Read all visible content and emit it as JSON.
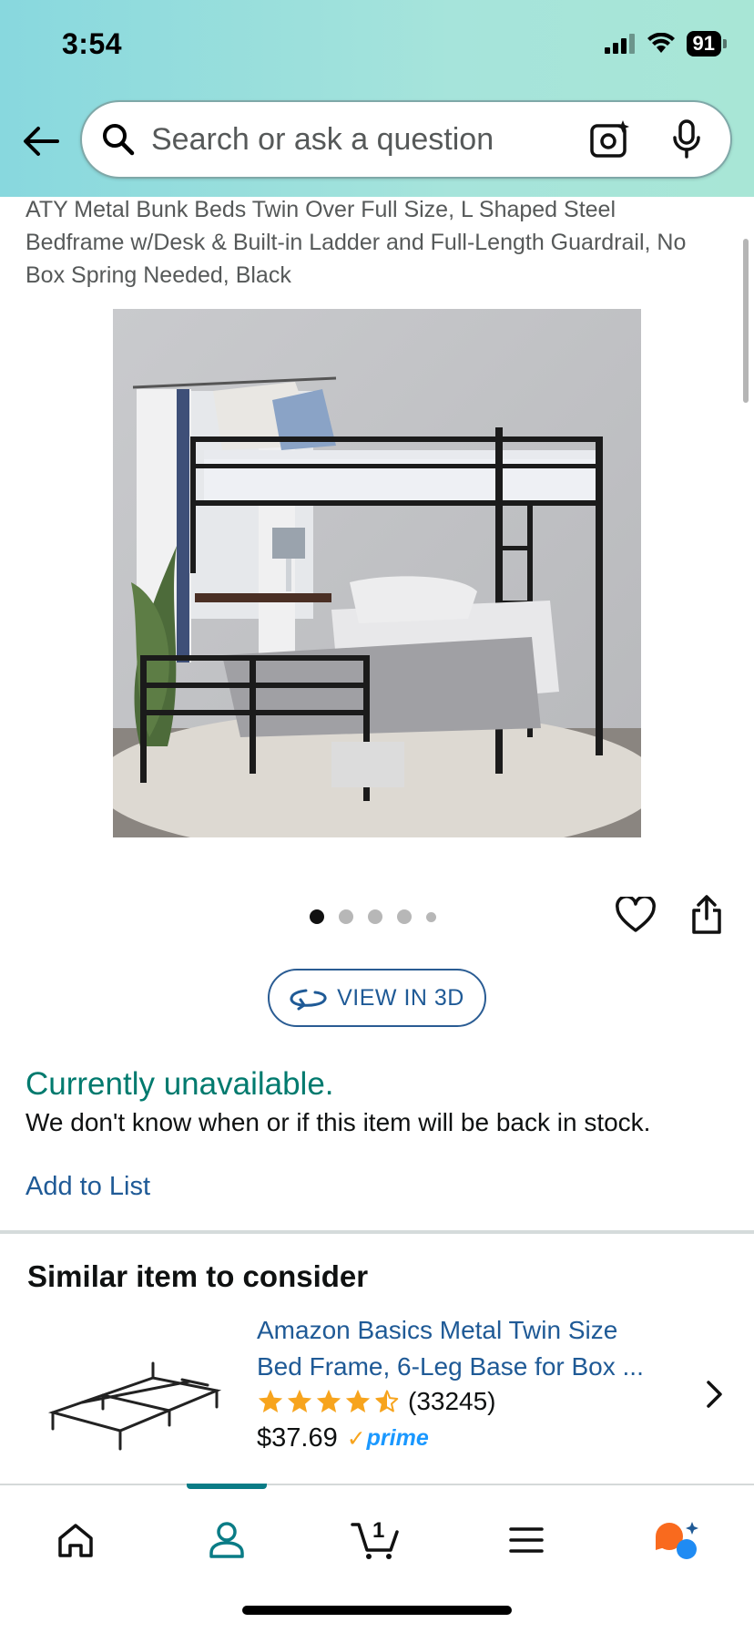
{
  "status_bar": {
    "time": "3:54",
    "battery": "91"
  },
  "search": {
    "placeholder": "Search or ask a question"
  },
  "product": {
    "title": "ATY Metal Bunk Beds Twin Over Full Size, L Shaped Steel Bedframe w/Desk & Built-in Ladder and Full-Length Guardrail, No Box Spring Needed, Black",
    "image_count": 5,
    "active_image": 1,
    "view3d_label": "VIEW IN 3D",
    "availability": "Currently unavailable.",
    "availability_detail": "We don't know when or if this item will be back in stock.",
    "add_to_list": "Add to List"
  },
  "similar": {
    "heading": "Similar item to consider",
    "name_line1": "Amazon Basics Metal Twin Size",
    "name_line2": "Bed Frame, 6-Leg Base for Box ...",
    "rating": 4.5,
    "rating_count": "(33245)",
    "price": "$37.69",
    "prime_label": "prime"
  },
  "bottom_nav": {
    "items": [
      "home",
      "account",
      "cart",
      "menu",
      "rufus"
    ],
    "active": "account",
    "cart_count": "1"
  },
  "colors": {
    "link": "#1f5a96",
    "availability": "#007a6e",
    "star": "#f7a41d",
    "active_nav": "#0a7c86"
  }
}
